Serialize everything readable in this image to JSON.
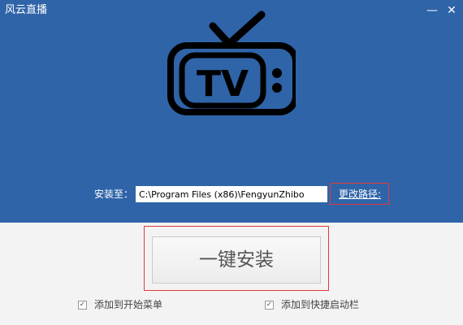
{
  "window": {
    "title": "风云直播",
    "minimize_label": "—",
    "close_label": "✕"
  },
  "logo": {
    "text": "TV",
    "icon": "tv-icon"
  },
  "install_path": {
    "label": "安装至：",
    "value": "C:\\Program Files (x86)\\FengyunZhibo",
    "change_label": "更改路径:"
  },
  "install_button": {
    "label": "一键安装"
  },
  "options": [
    {
      "label": "添加到开始菜单",
      "checked": true,
      "mark": "✓"
    },
    {
      "label": "添加到快捷启动栏",
      "checked": true,
      "mark": "✓"
    }
  ],
  "colors": {
    "header_bg": "#2f64a8",
    "highlight_border": "#e03a3a",
    "body_bg": "#f3f3f3"
  }
}
